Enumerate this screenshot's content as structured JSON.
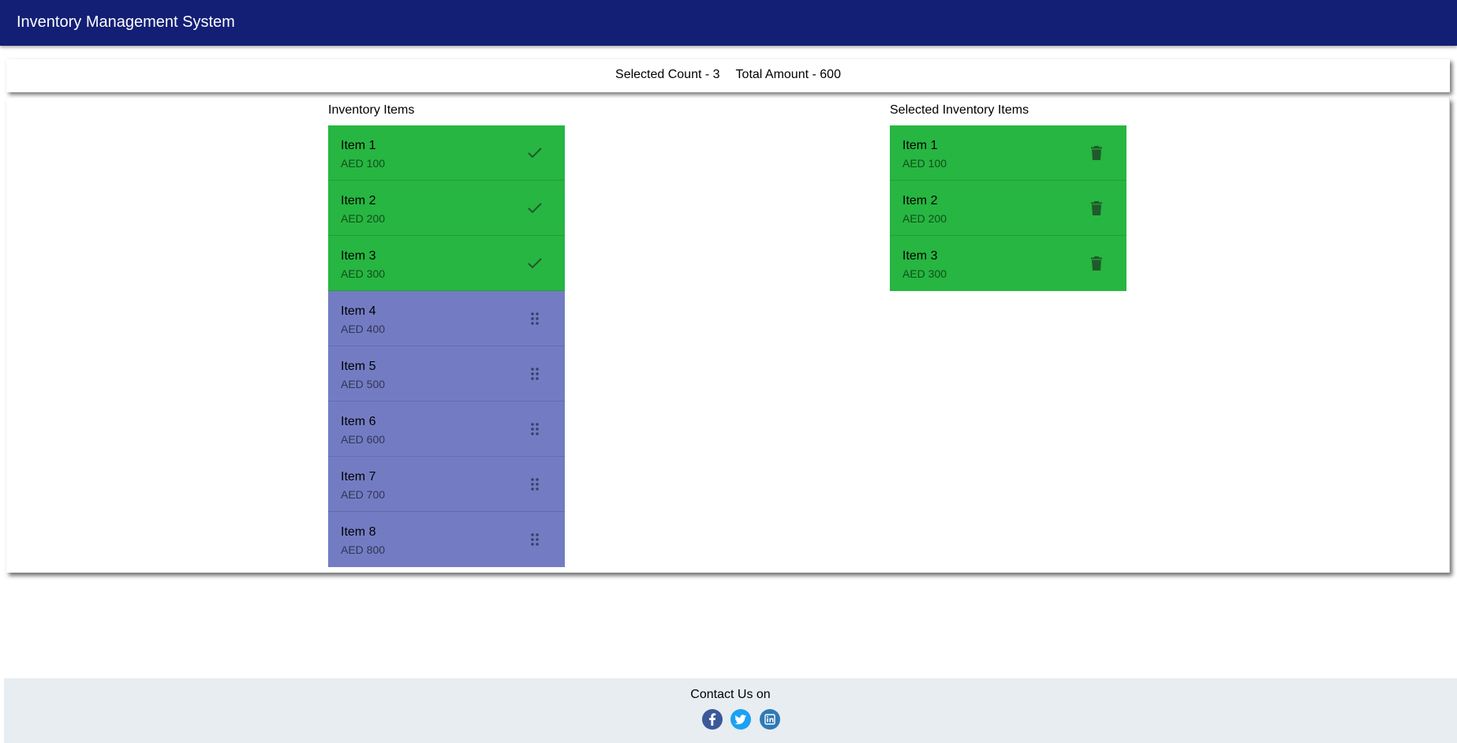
{
  "header": {
    "title": "Inventory Management System"
  },
  "summary": {
    "selected_count": "Selected Count - 3",
    "total_amount": "Total Amount - 600"
  },
  "inventory": {
    "title": "Inventory Items",
    "items": [
      {
        "name": "Item 1",
        "price": "AED 100",
        "selected": true
      },
      {
        "name": "Item 2",
        "price": "AED 200",
        "selected": true
      },
      {
        "name": "Item 3",
        "price": "AED 300",
        "selected": true
      },
      {
        "name": "Item 4",
        "price": "AED 400",
        "selected": false
      },
      {
        "name": "Item 5",
        "price": "AED 500",
        "selected": false
      },
      {
        "name": "Item 6",
        "price": "AED 600",
        "selected": false
      },
      {
        "name": "Item 7",
        "price": "AED 700",
        "selected": false
      },
      {
        "name": "Item 8",
        "price": "AED 800",
        "selected": false
      }
    ]
  },
  "selected": {
    "title": "Selected Inventory Items",
    "items": [
      {
        "name": "Item 1",
        "price": "AED 100"
      },
      {
        "name": "Item 2",
        "price": "AED 200"
      },
      {
        "name": "Item 3",
        "price": "AED 300"
      }
    ]
  },
  "footer": {
    "contact": "Contact Us on",
    "socials": [
      "facebook-icon",
      "twitter-icon",
      "linkedin-icon"
    ]
  },
  "colors": {
    "appbar": "#131f75",
    "selected_item": "#27b641",
    "unselected_item": "#737cc3",
    "footer": "#e8edf1"
  }
}
